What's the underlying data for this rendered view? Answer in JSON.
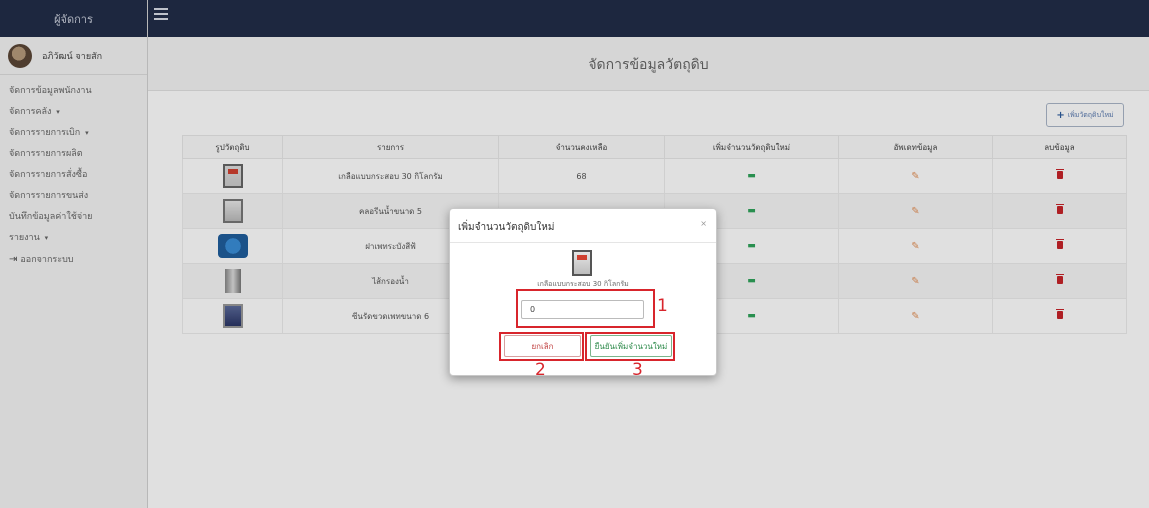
{
  "sidebar": {
    "header": "ผู้จัดการ",
    "user_name": "อภิวัฒน์ จายสัก",
    "items": [
      {
        "label": "จัดการข้อมูลพนักงาน",
        "dropdown": false
      },
      {
        "label": "จัดการคลัง",
        "dropdown": true
      },
      {
        "label": "จัดการรายการเบิก",
        "dropdown": true
      },
      {
        "label": "จัดการรายการผลิต",
        "dropdown": false
      },
      {
        "label": "จัดการรายการสั่งซื้อ",
        "dropdown": false
      },
      {
        "label": "จัดการรายการขนส่ง",
        "dropdown": false
      },
      {
        "label": "บันทึกข้อมูลค่าใช้จ่าย",
        "dropdown": false
      },
      {
        "label": "รายงาน",
        "dropdown": true
      },
      {
        "label": "ออกจากระบบ",
        "dropdown": false
      }
    ],
    "dropdown_arrow": "▾",
    "logout_icon": "sign-out-icon"
  },
  "page": {
    "title": "จัดการข้อมูลวัตถุดิบ",
    "add_button": "เพิ่มวัตถุดิบใหม่"
  },
  "table": {
    "headers": [
      "รูปวัตถุดิบ",
      "รายการ",
      "จำนวนคงเหลือ",
      "เพิ่มจำนวนวัตถุดิบใหม่",
      "อัพเดทข้อมูล",
      "ลบข้อมูล"
    ],
    "rows": [
      {
        "name": "เกลือแบบกระสอบ 30 กิโลกรัม",
        "remaining": "68"
      },
      {
        "name": "คลอรีนน้ำขนาด 5",
        "remaining": ""
      },
      {
        "name": "ฝาเพทระบังสีฟ้",
        "remaining": ""
      },
      {
        "name": "ไส้กรองน้ำ",
        "remaining": ""
      },
      {
        "name": "ซีนรัดขวดเพทขนาด 6",
        "remaining": ""
      }
    ]
  },
  "modal": {
    "title": "เพิ่มจำนวนวัตถุดิบใหม่",
    "close": "×",
    "item_name": "เกลือแบบกระสอบ 30 กิโลกรัม",
    "quantity_value": "0",
    "cancel_label": "ยกเลิก",
    "confirm_label": "ยืนยันเพิ่มจำนวนใหม่"
  },
  "annotations": [
    {
      "number": "1"
    },
    {
      "number": "2"
    },
    {
      "number": "3"
    }
  ],
  "colors": {
    "navbar": "#222d48",
    "annotation": "#d8252c",
    "money_icon": "#2fa35a",
    "edit_icon": "#e4925a",
    "delete_icon": "#c8242a"
  }
}
